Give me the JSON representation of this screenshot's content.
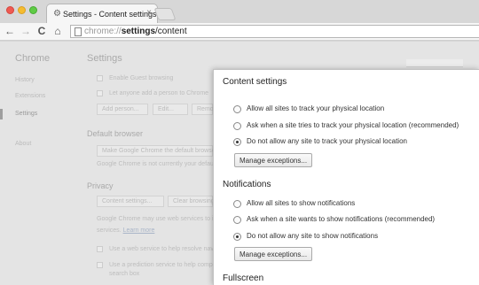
{
  "window": {
    "tab": {
      "icon": "gear-icon",
      "title": "Settings - Content settings",
      "close": "×"
    },
    "traffic_lights": {
      "close": "#ef5a52",
      "minimize": "#f5bc2f",
      "zoom": "#5fcb45"
    }
  },
  "toolbar": {
    "back": "←",
    "forward": "→",
    "reload": "C",
    "home": "⌂",
    "url_scheme": "chrome://",
    "url_host": "settings",
    "url_path": "/content"
  },
  "sidebar": {
    "title": "Chrome",
    "items": [
      {
        "label": "History"
      },
      {
        "label": "Extensions"
      },
      {
        "label": "Settings"
      },
      {
        "label": "About"
      }
    ]
  },
  "main": {
    "title": "Settings",
    "people": {
      "guest": "Enable Guest browsing",
      "anyone": "Let anyone add a person to Chrome",
      "add_person": "Add person...",
      "edit": "Edit...",
      "remove": "Remove..."
    },
    "default_browser": {
      "heading": "Default browser",
      "button": "Make Google Chrome the default browser",
      "status": "Google Chrome is not currently your default browser."
    },
    "privacy": {
      "heading": "Privacy",
      "content_btn": "Content settings...",
      "clear_btn": "Clear browsing data...",
      "desc": "Google Chrome may use web services to improve your browsing experience.",
      "desc2": "services.",
      "learn_more": "Learn more",
      "opt1": "Use a web service to help resolve navigation errors",
      "opt2": "Use a prediction service to help complete searches and URLs typed in the address bar or the app launcher",
      "opt2b": "search box"
    }
  },
  "dialog": {
    "title": "Content settings",
    "location": {
      "options": [
        {
          "label": "Allow all sites to track your physical location",
          "checked": false
        },
        {
          "label": "Ask when a site tries to track your physical location (recommended)",
          "checked": false
        },
        {
          "label": "Do not allow any site to track your physical location",
          "checked": true
        }
      ],
      "button": "Manage exceptions..."
    },
    "notifications": {
      "heading": "Notifications",
      "options": [
        {
          "label": "Allow all sites to show notifications",
          "checked": false
        },
        {
          "label": "Ask when a site wants to show notifications (recommended)",
          "checked": false
        },
        {
          "label": "Do not allow any site to show notifications",
          "checked": true
        }
      ],
      "button": "Manage exceptions..."
    },
    "fullscreen": {
      "heading": "Fullscreen"
    }
  }
}
